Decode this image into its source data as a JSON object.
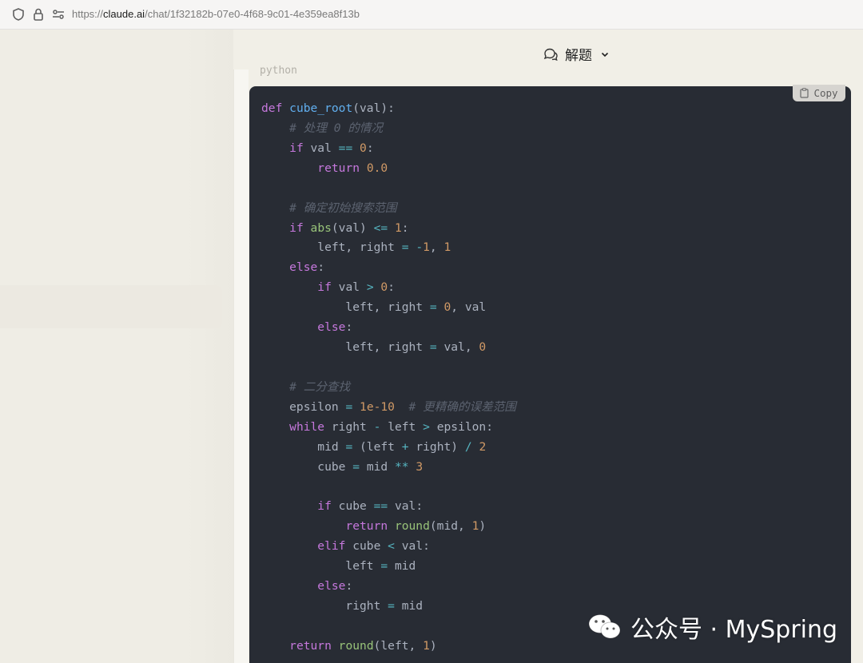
{
  "browser": {
    "url_scheme": "https://",
    "url_host": "claude.ai",
    "url_path": "/chat/1f32182b-07e0-4f68-9c01-4e359ea8f13b",
    "icons": [
      "shield-icon",
      "lock-icon",
      "site-settings-icon"
    ]
  },
  "header": {
    "title": "解题",
    "icon": "chat-bubbles-icon",
    "chevron": "chevron-down-icon"
  },
  "code_block": {
    "language": "python",
    "copy_label": "Copy",
    "lines": [
      [
        [
          "kw",
          "def"
        ],
        [
          "t",
          " "
        ],
        [
          "fn",
          "cube_root"
        ],
        [
          "t",
          "(val):"
        ]
      ],
      [
        [
          "t",
          "    "
        ],
        [
          "cm",
          "# 处理 0 的情况"
        ]
      ],
      [
        [
          "t",
          "    "
        ],
        [
          "kw",
          "if"
        ],
        [
          "t",
          " val "
        ],
        [
          "op",
          "=="
        ],
        [
          "t",
          " "
        ],
        [
          "num",
          "0"
        ],
        [
          "t",
          ":"
        ]
      ],
      [
        [
          "t",
          "        "
        ],
        [
          "kw",
          "return"
        ],
        [
          "t",
          " "
        ],
        [
          "num",
          "0.0"
        ]
      ],
      [
        [
          "t",
          ""
        ]
      ],
      [
        [
          "t",
          "    "
        ],
        [
          "cm",
          "# 确定初始搜索范围"
        ]
      ],
      [
        [
          "t",
          "    "
        ],
        [
          "kw",
          "if"
        ],
        [
          "t",
          " "
        ],
        [
          "bi",
          "abs"
        ],
        [
          "t",
          "(val) "
        ],
        [
          "op",
          "<="
        ],
        [
          "t",
          " "
        ],
        [
          "num",
          "1"
        ],
        [
          "t",
          ":"
        ]
      ],
      [
        [
          "t",
          "        left, right "
        ],
        [
          "op",
          "="
        ],
        [
          "t",
          " "
        ],
        [
          "op",
          "-"
        ],
        [
          "num",
          "1"
        ],
        [
          "t",
          ", "
        ],
        [
          "num",
          "1"
        ]
      ],
      [
        [
          "t",
          "    "
        ],
        [
          "kw",
          "else"
        ],
        [
          "t",
          ":"
        ]
      ],
      [
        [
          "t",
          "        "
        ],
        [
          "kw",
          "if"
        ],
        [
          "t",
          " val "
        ],
        [
          "op",
          ">"
        ],
        [
          "t",
          " "
        ],
        [
          "num",
          "0"
        ],
        [
          "t",
          ":"
        ]
      ],
      [
        [
          "t",
          "            left, right "
        ],
        [
          "op",
          "="
        ],
        [
          "t",
          " "
        ],
        [
          "num",
          "0"
        ],
        [
          "t",
          ", val"
        ]
      ],
      [
        [
          "t",
          "        "
        ],
        [
          "kw",
          "else"
        ],
        [
          "t",
          ":"
        ]
      ],
      [
        [
          "t",
          "            left, right "
        ],
        [
          "op",
          "="
        ],
        [
          "t",
          " val, "
        ],
        [
          "num",
          "0"
        ]
      ],
      [
        [
          "t",
          ""
        ]
      ],
      [
        [
          "t",
          "    "
        ],
        [
          "cm",
          "# 二分查找"
        ]
      ],
      [
        [
          "t",
          "    epsilon "
        ],
        [
          "op",
          "="
        ],
        [
          "t",
          " "
        ],
        [
          "num",
          "1e-10"
        ],
        [
          "t",
          "  "
        ],
        [
          "cm",
          "# 更精确的误差范围"
        ]
      ],
      [
        [
          "t",
          "    "
        ],
        [
          "kw",
          "while"
        ],
        [
          "t",
          " right "
        ],
        [
          "op",
          "-"
        ],
        [
          "t",
          " left "
        ],
        [
          "op",
          ">"
        ],
        [
          "t",
          " epsilon:"
        ]
      ],
      [
        [
          "t",
          "        mid "
        ],
        [
          "op",
          "="
        ],
        [
          "t",
          " (left "
        ],
        [
          "op",
          "+"
        ],
        [
          "t",
          " right) "
        ],
        [
          "op",
          "/"
        ],
        [
          "t",
          " "
        ],
        [
          "num",
          "2"
        ]
      ],
      [
        [
          "t",
          "        cube "
        ],
        [
          "op",
          "="
        ],
        [
          "t",
          " mid "
        ],
        [
          "op",
          "**"
        ],
        [
          "t",
          " "
        ],
        [
          "num",
          "3"
        ]
      ],
      [
        [
          "t",
          ""
        ]
      ],
      [
        [
          "t",
          "        "
        ],
        [
          "kw",
          "if"
        ],
        [
          "t",
          " cube "
        ],
        [
          "op",
          "=="
        ],
        [
          "t",
          " val:"
        ]
      ],
      [
        [
          "t",
          "            "
        ],
        [
          "kw",
          "return"
        ],
        [
          "t",
          " "
        ],
        [
          "bi",
          "round"
        ],
        [
          "t",
          "(mid, "
        ],
        [
          "num",
          "1"
        ],
        [
          "t",
          ")"
        ]
      ],
      [
        [
          "t",
          "        "
        ],
        [
          "kw",
          "elif"
        ],
        [
          "t",
          " cube "
        ],
        [
          "op",
          "<"
        ],
        [
          "t",
          " val:"
        ]
      ],
      [
        [
          "t",
          "            left "
        ],
        [
          "op",
          "="
        ],
        [
          "t",
          " mid"
        ]
      ],
      [
        [
          "t",
          "        "
        ],
        [
          "kw",
          "else"
        ],
        [
          "t",
          ":"
        ]
      ],
      [
        [
          "t",
          "            right "
        ],
        [
          "op",
          "="
        ],
        [
          "t",
          " mid"
        ]
      ],
      [
        [
          "t",
          ""
        ]
      ],
      [
        [
          "t",
          "    "
        ],
        [
          "kw",
          "return"
        ],
        [
          "t",
          " "
        ],
        [
          "bi",
          "round"
        ],
        [
          "t",
          "(left, "
        ],
        [
          "num",
          "1"
        ],
        [
          "t",
          ")"
        ]
      ]
    ]
  },
  "watermark": {
    "text": "公众号 · MySpring",
    "icon": "wechat-icon"
  },
  "colors": {
    "code_bg": "#282c34",
    "keyword": "#c678dd",
    "function": "#61afef",
    "comment": "#5c6370",
    "number": "#d19a66",
    "operator": "#56b6c2",
    "builtin": "#98c379"
  }
}
